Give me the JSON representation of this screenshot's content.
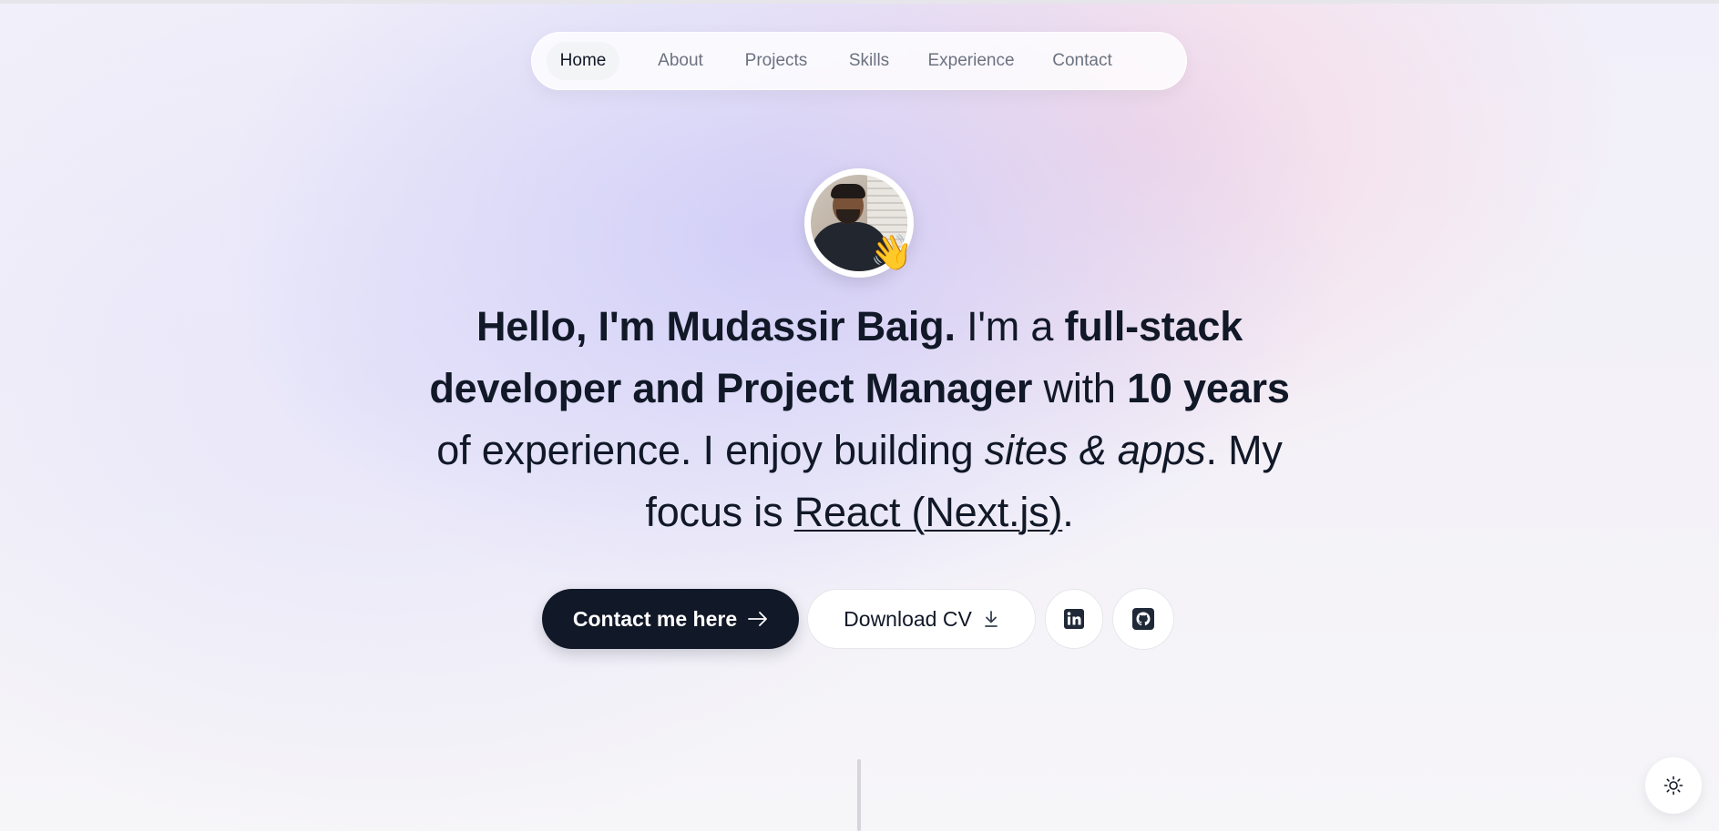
{
  "nav": {
    "items": [
      {
        "label": "Home",
        "active": true
      },
      {
        "label": "About"
      },
      {
        "label": "Projects"
      },
      {
        "label": "Skills"
      },
      {
        "label": "Experience"
      },
      {
        "label": "Contact"
      }
    ]
  },
  "hero": {
    "avatar_badge": "👋",
    "headline": {
      "p1": "Hello, I'm Mudassir Baig.",
      "p2": " I'm a ",
      "p3": "full-stack developer and Project Manager",
      "p4": " with ",
      "p5": "10 years",
      "p6": " of experience. I enjoy building ",
      "p7": "sites & apps",
      "p8": ". My focus is ",
      "p9": "React (Next.js)",
      "p10": "."
    }
  },
  "actions": {
    "contact_label": "Contact me here",
    "contact_icon": "arrow-right-icon",
    "cv_label": "Download CV",
    "cv_icon": "download-icon",
    "linkedin_icon": "linkedin-icon",
    "github_icon": "github-icon"
  },
  "theme_toggle": {
    "icon": "sun-icon"
  },
  "colors": {
    "primary_dark": "#111827",
    "muted_text": "#6b7280",
    "surface": "#ffffff"
  }
}
